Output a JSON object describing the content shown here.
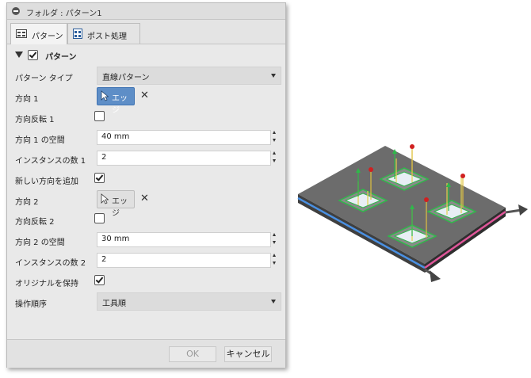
{
  "window": {
    "title": "フォルダ : パターン1"
  },
  "tabs": [
    {
      "label": "パターン",
      "icon": "pattern-icon",
      "active": true
    },
    {
      "label": "ポスト処理",
      "icon": "post-process-icon",
      "active": false
    }
  ],
  "section": {
    "title": "パターン",
    "checked": true
  },
  "form": {
    "pattern_type": {
      "label": "パターン タイプ",
      "value": "直線パターン"
    },
    "direction1": {
      "label": "方向 1",
      "button": "エッジ"
    },
    "flip1": {
      "label": "方向反転 1",
      "checked": false
    },
    "spacing1": {
      "label": "方向 1 の空間",
      "value": "40 mm"
    },
    "count1": {
      "label": "インスタンスの数 1",
      "value": "2"
    },
    "add_direction": {
      "label": "新しい方向を追加",
      "checked": true
    },
    "direction2": {
      "label": "方向 2",
      "button": "エッジ"
    },
    "flip2": {
      "label": "方向反転 2",
      "checked": false
    },
    "spacing2": {
      "label": "方向 2 の空間",
      "value": "30 mm"
    },
    "count2": {
      "label": "インスタンスの数 2",
      "value": "2"
    },
    "keep_original": {
      "label": "オリジナルを保持",
      "checked": true
    },
    "operation_order": {
      "label": "操作順序",
      "value": "工具順"
    }
  },
  "footer": {
    "ok": "OK",
    "cancel": "キャンセル"
  },
  "colors": {
    "accent": "#5e8ec7",
    "edge_direction1": "#4a90e2",
    "edge_direction2": "#e0569a",
    "toolpath": "#2fb84a"
  }
}
